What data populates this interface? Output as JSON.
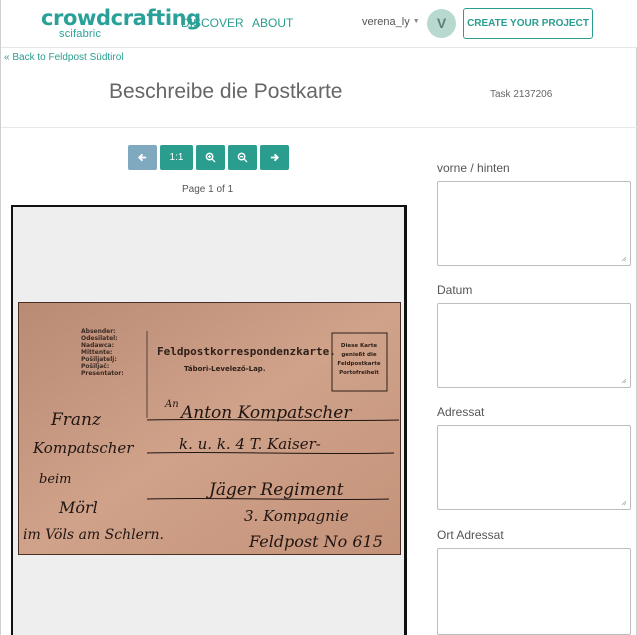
{
  "navbar": {
    "logo_main": "crowdcrafting",
    "logo_sub": "scifabric",
    "links": [
      {
        "label": "Discover"
      },
      {
        "label": "About"
      }
    ],
    "username": "verena_ly",
    "avatar_initial": "V",
    "create_button": "Create your project"
  },
  "back_link": "« Back to Feldpost Südtirol",
  "title": "Beschreibe die Postkarte",
  "task_id": "Task 2137206",
  "toolbar": {
    "zoom_reset_label": "1:1",
    "icons": [
      "arrow-left-icon",
      "zoom-in-icon",
      "zoom-out-icon",
      "arrow-right-icon"
    ],
    "page_info": "Page 1 of 1"
  },
  "postcard": {
    "sender_labels": [
      "Absender:",
      "Odesilatel:",
      "Nadawca:",
      "Mittente:",
      "Pošiljatelj:",
      "Pošiljač:",
      "Presentator:"
    ],
    "header": "Feldpostkorrespondenzkarte.",
    "subheader": "Tábori-Levelező-Lap.",
    "stamp_box": [
      "Diese Karte",
      "genießt die",
      "Feldpostkarte",
      "Portofreiheit"
    ],
    "handwriting_left": [
      "Franz",
      "Kompatscher",
      "beim",
      "Mörl",
      "im Völs am Schlern."
    ],
    "handwriting_right": [
      "An",
      "Anton Kompatscher",
      "k. u. k. 4 T. Kaiser-",
      "Jäger Regiment",
      "3. Kompagnie",
      "Feldpost No 615"
    ]
  },
  "fields": [
    {
      "label": "vorne / hinten",
      "value": ""
    },
    {
      "label": "Datum",
      "value": ""
    },
    {
      "label": "Adressat",
      "value": ""
    },
    {
      "label": "Ort Adressat",
      "value": ""
    }
  ],
  "colors": {
    "accent": "#2a9d8f",
    "disabled_button": "#7fa9bf",
    "postcard": "#c89a82"
  }
}
